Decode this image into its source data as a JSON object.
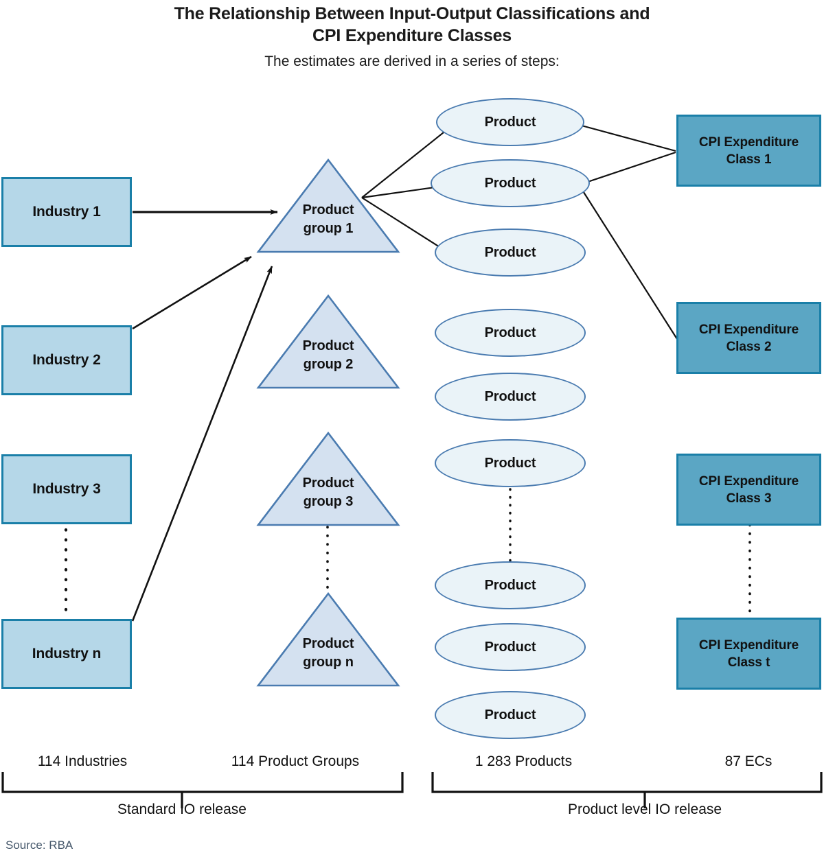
{
  "header": {
    "title_line1": "The Relationship Between Input-Output Classifications and",
    "title_line2": "CPI Expenditure Classes",
    "subtitle": "The estimates are derived in a series of steps:"
  },
  "colors": {
    "industry_fill": "#b5d7e8",
    "industry_border": "#1a7fa8",
    "cpi_fill": "#5ba6c4",
    "cpi_border": "#1a7fa8",
    "triangle_fill": "#d4e1f0",
    "triangle_border": "#4a7bb0",
    "ellipse_fill": "#eaf3f8",
    "ellipse_border": "#4a7bb0",
    "connector": "#111111",
    "source_text": "#46586b"
  },
  "columns": {
    "industries": {
      "nodes": [
        {
          "label": "Industry 1"
        },
        {
          "label": "Industry 2"
        },
        {
          "label": "Industry 3"
        },
        {
          "label": "Industry n"
        }
      ],
      "count_label": "114 Industries"
    },
    "product_groups": {
      "nodes": [
        {
          "label_line1": "Product",
          "label_line2": "group 1"
        },
        {
          "label_line1": "Product",
          "label_line2": "group 2"
        },
        {
          "label_line1": "Product",
          "label_line2": "group 3"
        },
        {
          "label_line1": "Product",
          "label_line2": "group n"
        }
      ],
      "count_label": "114 Product Groups"
    },
    "products": {
      "nodes": [
        {
          "label": "Product"
        },
        {
          "label": "Product"
        },
        {
          "label": "Product"
        },
        {
          "label": "Product"
        },
        {
          "label": "Product"
        },
        {
          "label": "Product"
        },
        {
          "label": "Product"
        },
        {
          "label": "Product"
        },
        {
          "label": "Product"
        }
      ],
      "count_label": "1 283 Products"
    },
    "cpi_classes": {
      "nodes": [
        {
          "label_line1": "CPI Expenditure",
          "label_line2": "Class 1"
        },
        {
          "label_line1": "CPI Expenditure",
          "label_line2": "Class 2"
        },
        {
          "label_line1": "CPI Expenditure",
          "label_line2": "Class 3"
        },
        {
          "label_line1": "CPI Expenditure",
          "label_line2": "Class t"
        }
      ],
      "count_label": "87 ECs"
    }
  },
  "brackets": {
    "left_release_label": "Standard IO release",
    "right_release_label": "Product level IO release"
  },
  "footer": {
    "source": "Source: RBA"
  }
}
